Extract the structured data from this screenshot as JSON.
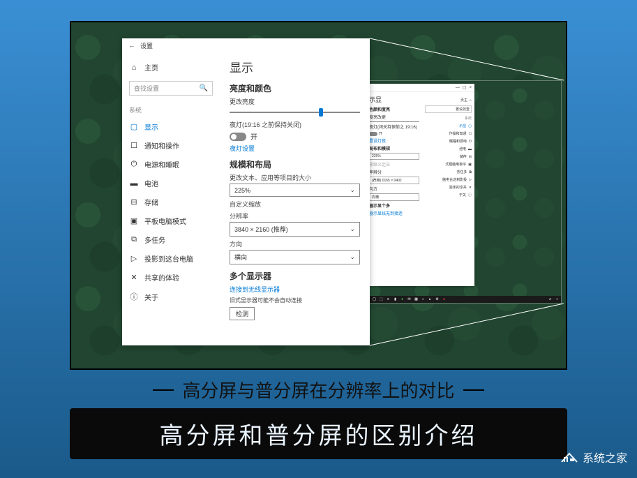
{
  "frame": {
    "caption_subtitle": "高分屏与普分屏在分辨率上的对比",
    "caption_title": "高分屏和普分屏的区别介绍"
  },
  "watermark": {
    "text": "系统之家"
  },
  "large_window": {
    "header_title": "设置",
    "sidebar": {
      "home": "主页",
      "search_placeholder": "查找设置",
      "section_label": "系统",
      "items": [
        {
          "icon": "display",
          "label": "显示"
        },
        {
          "icon": "notify",
          "label": "通知和操作"
        },
        {
          "icon": "power",
          "label": "电源和睡眠"
        },
        {
          "icon": "battery",
          "label": "电池"
        },
        {
          "icon": "storage",
          "label": "存储"
        },
        {
          "icon": "tablet",
          "label": "平板电脑模式"
        },
        {
          "icon": "multitask",
          "label": "多任务"
        },
        {
          "icon": "project",
          "label": "投影到这台电脑"
        },
        {
          "icon": "shared",
          "label": "共享的体验"
        },
        {
          "icon": "about",
          "label": "关于"
        }
      ]
    },
    "content": {
      "title": "显示",
      "section_brightness": "亮度和颜色",
      "brightness_label": "更改亮度",
      "nightlight_label": "夜灯(19:16 之前保持关闭)",
      "toggle_on": "开",
      "nightlight_settings": "夜灯设置",
      "section_scale": "规模和布局",
      "scale_label": "更改文本、应用等项目的大小",
      "scale_value": "225%",
      "custom_scale": "自定义缩放",
      "resolution_label": "分辨率",
      "resolution_value": "3840 × 2160 (推荐)",
      "orientation_label": "方向",
      "orientation_value": "横向",
      "section_multi": "多个显示器",
      "wireless_label": "连接到无线显示器",
      "old_display_note": "旧式显示器可能不会自动连接",
      "detect_button": "检测"
    }
  },
  "small_window": {
    "title": "示显",
    "section1": "色颜和度亮",
    "section2": "度亮改更",
    "right_search": "置设找查",
    "right_home": "页主",
    "right_section": "系统",
    "right_items": [
      "示显",
      "作操和知通",
      "眠睡和源电",
      "池电",
      "储存",
      "式模脑电板平",
      "务任多",
      "脑电台这到影投",
      "验体的享共",
      "于关"
    ],
    "left_items": [
      "开",
      "置设灯夜",
      "局布和模规",
      "225%",
      "放缩义定自",
      "率辨分",
      "(荐推) 0165 × 0402",
      "向方",
      "向横",
      "器示显个多",
      "器示显线无到接连"
    ],
    "nightlight_small": "夜灯(闭关持保前之 19:16)"
  },
  "taskbar": {
    "icons": [
      "⊞",
      "◯",
      "⬚",
      "e",
      "📁",
      "⊕",
      "✉",
      "📅",
      "📷",
      "▶",
      "⚙",
      "◐",
      "●",
      "●",
      "●",
      "▣"
    ]
  }
}
